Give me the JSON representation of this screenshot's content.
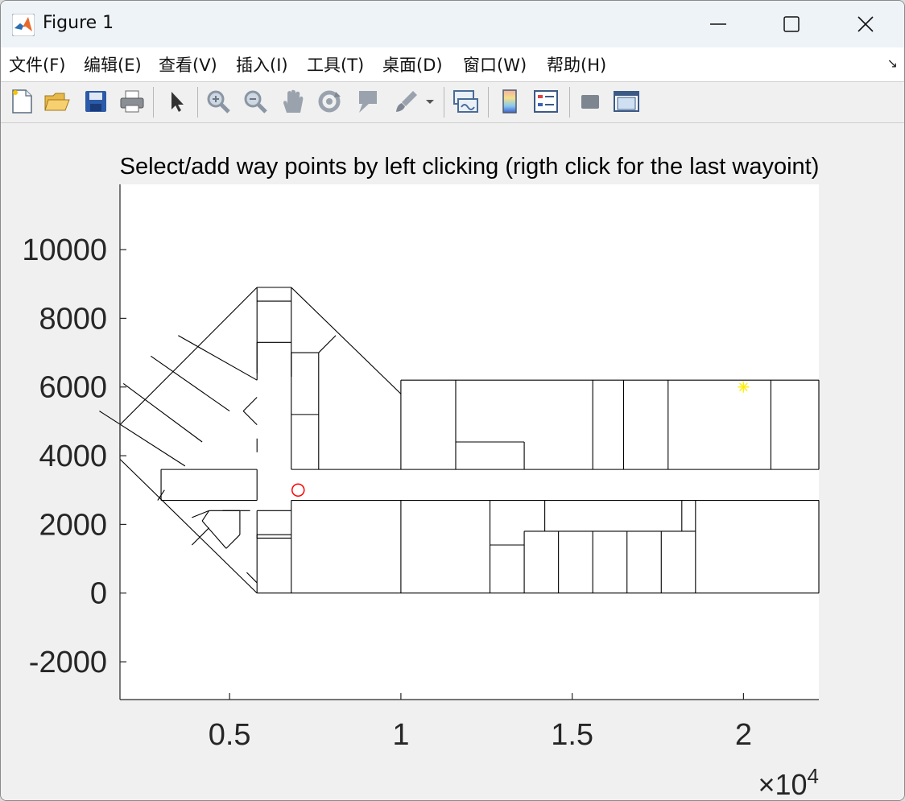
{
  "window": {
    "title": "Figure 1"
  },
  "menu": [
    {
      "label": "文件(F)"
    },
    {
      "label": "编辑(E)"
    },
    {
      "label": "查看(V)"
    },
    {
      "label": "插入(I)"
    },
    {
      "label": "工具(T)"
    },
    {
      "label": "桌面(D)"
    },
    {
      "label": "窗口(W)"
    },
    {
      "label": "帮助(H)"
    }
  ],
  "toolbar": {
    "icons": [
      "new-figure-icon",
      "open-file-icon",
      "save-icon",
      "print-icon",
      "select-arrow-icon",
      "zoom-in-icon",
      "zoom-out-icon",
      "pan-hand-icon",
      "rotate-3d-icon",
      "data-cursor-icon",
      "brush-icon",
      "link-plot-icon",
      "colorbar-icon",
      "legend-icon",
      "hide-plot-tools-icon",
      "show-plot-tools-icon"
    ]
  },
  "chart_data": {
    "type": "line",
    "title": "Select/add way points by left clicking (rigth click for the last wayoint)",
    "xlabel": "",
    "ylabel": "",
    "xlim": [
      1800,
      22200
    ],
    "ylim": [
      -3100,
      11900
    ],
    "x_ticks": [
      5000,
      10000,
      15000,
      20000
    ],
    "x_tick_labels": [
      "0.5",
      "1",
      "1.5",
      "2"
    ],
    "x_exponent_label": "×10^4",
    "x_exponent_prefix": "×10",
    "x_exponent_power": "4",
    "y_ticks": [
      -2000,
      0,
      2000,
      4000,
      6000,
      8000,
      10000
    ],
    "y_tick_labels": [
      "-2000",
      "0",
      "2000",
      "4000",
      "6000",
      "8000",
      "10000"
    ],
    "grid": false,
    "markers": [
      {
        "name": "start",
        "x": 7000,
        "y": 3000,
        "shape": "circle",
        "color": "#ff0000"
      },
      {
        "name": "goal",
        "x": 20000,
        "y": 6000,
        "shape": "asterisk",
        "color": "#ffee00"
      }
    ],
    "floor_plan_segments": [
      [
        [
          1800,
          4900
        ],
        [
          5800,
          8900
        ]
      ],
      [
        [
          5800,
          8900
        ],
        [
          6800,
          8900
        ]
      ],
      [
        [
          6800,
          8900
        ],
        [
          10000,
          5800
        ]
      ],
      [
        [
          1800,
          4900
        ],
        [
          1800,
          3900
        ]
      ],
      [
        [
          1800,
          3900
        ],
        [
          5800,
          0
        ]
      ],
      [
        [
          5800,
          0
        ],
        [
          22200,
          0
        ]
      ],
      [
        [
          10000,
          6200
        ],
        [
          22200,
          6200
        ]
      ],
      [
        [
          10000,
          6200
        ],
        [
          10000,
          3600
        ]
      ],
      [
        [
          22200,
          6200
        ],
        [
          22200,
          3600
        ]
      ],
      [
        [
          6800,
          3600
        ],
        [
          22200,
          3600
        ]
      ],
      [
        [
          6800,
          2700
        ],
        [
          22200,
          2700
        ]
      ],
      [
        [
          22200,
          2700
        ],
        [
          22200,
          0
        ]
      ],
      [
        [
          5800,
          8900
        ],
        [
          5800,
          6200
        ]
      ],
      [
        [
          6800,
          8900
        ],
        [
          6800,
          6300
        ]
      ],
      [
        [
          5800,
          8500
        ],
        [
          6800,
          8500
        ]
      ],
      [
        [
          5800,
          7300
        ],
        [
          6800,
          7300
        ]
      ],
      [
        [
          5800,
          7300
        ],
        [
          5800,
          6400
        ]
      ],
      [
        [
          6800,
          7000
        ],
        [
          7600,
          7000
        ]
      ],
      [
        [
          6800,
          7000
        ],
        [
          6800,
          3600
        ]
      ],
      [
        [
          7600,
          7000
        ],
        [
          7600,
          3600
        ]
      ],
      [
        [
          6800,
          5200
        ],
        [
          7600,
          5200
        ]
      ],
      [
        [
          7600,
          7000
        ],
        [
          8100,
          7500
        ]
      ],
      [
        [
          3500,
          7500
        ],
        [
          5800,
          6200
        ]
      ],
      [
        [
          2700,
          6900
        ],
        [
          5000,
          5300
        ]
      ],
      [
        [
          1900,
          6100
        ],
        [
          4200,
          4400
        ]
      ],
      [
        [
          1200,
          5300
        ],
        [
          3700,
          3700
        ]
      ],
      [
        [
          5800,
          5700
        ],
        [
          5400,
          5300
        ]
      ],
      [
        [
          5400,
          5300
        ],
        [
          5800,
          4900
        ]
      ],
      [
        [
          5800,
          4500
        ],
        [
          5800,
          4100
        ]
      ],
      [
        [
          3000,
          3600
        ],
        [
          5800,
          3600
        ]
      ],
      [
        [
          3000,
          3600
        ],
        [
          3000,
          2700
        ]
      ],
      [
        [
          3000,
          2700
        ],
        [
          5800,
          2700
        ]
      ],
      [
        [
          5800,
          2700
        ],
        [
          5800,
          3600
        ]
      ],
      [
        [
          2900,
          2700
        ],
        [
          3100,
          3000
        ]
      ],
      [
        [
          4400,
          2400
        ],
        [
          3900,
          2200
        ]
      ],
      [
        [
          4800,
          2400
        ],
        [
          5600,
          2400
        ]
      ],
      [
        [
          4400,
          2400
        ],
        [
          5300,
          2400
        ]
      ],
      [
        [
          5300,
          2400
        ],
        [
          5300,
          1700
        ]
      ],
      [
        [
          5300,
          1700
        ],
        [
          4900,
          1300
        ]
      ],
      [
        [
          4900,
          1300
        ],
        [
          4200,
          2100
        ]
      ],
      [
        [
          4200,
          2100
        ],
        [
          4400,
          2400
        ]
      ],
      [
        [
          4400,
          1900
        ],
        [
          3900,
          1400
        ]
      ],
      [
        [
          5800,
          2400
        ],
        [
          6800,
          2400
        ]
      ],
      [
        [
          5800,
          2400
        ],
        [
          5800,
          1600
        ]
      ],
      [
        [
          5800,
          1600
        ],
        [
          6800,
          1600
        ]
      ],
      [
        [
          5800,
          1700
        ],
        [
          5800,
          0
        ]
      ],
      [
        [
          5500,
          600
        ],
        [
          5800,
          300
        ]
      ],
      [
        [
          6800,
          2700
        ],
        [
          6800,
          0
        ]
      ],
      [
        [
          5800,
          1700
        ],
        [
          6800,
          1700
        ]
      ],
      [
        [
          11600,
          6200
        ],
        [
          11600,
          3600
        ]
      ],
      [
        [
          11600,
          4400
        ],
        [
          13600,
          4400
        ]
      ],
      [
        [
          13600,
          4400
        ],
        [
          13600,
          3600
        ]
      ],
      [
        [
          15600,
          6200
        ],
        [
          15600,
          3600
        ]
      ],
      [
        [
          16500,
          6200
        ],
        [
          16500,
          3600
        ]
      ],
      [
        [
          17800,
          6200
        ],
        [
          17800,
          3600
        ]
      ],
      [
        [
          20800,
          6200
        ],
        [
          20800,
          3600
        ]
      ],
      [
        [
          10000,
          2700
        ],
        [
          10000,
          0
        ]
      ],
      [
        [
          12600,
          2700
        ],
        [
          12600,
          0
        ]
      ],
      [
        [
          12600,
          1400
        ],
        [
          13600,
          1400
        ]
      ],
      [
        [
          14200,
          2700
        ],
        [
          14200,
          1800
        ]
      ],
      [
        [
          13600,
          1800
        ],
        [
          18600,
          1800
        ]
      ],
      [
        [
          13600,
          1800
        ],
        [
          13600,
          0
        ]
      ],
      [
        [
          14600,
          1800
        ],
        [
          14600,
          0
        ]
      ],
      [
        [
          15600,
          1800
        ],
        [
          15600,
          0
        ]
      ],
      [
        [
          16600,
          1800
        ],
        [
          16600,
          0
        ]
      ],
      [
        [
          17600,
          1800
        ],
        [
          17600,
          0
        ]
      ],
      [
        [
          18600,
          2700
        ],
        [
          18600,
          0
        ]
      ],
      [
        [
          18200,
          2700
        ],
        [
          18200,
          1800
        ]
      ]
    ]
  }
}
